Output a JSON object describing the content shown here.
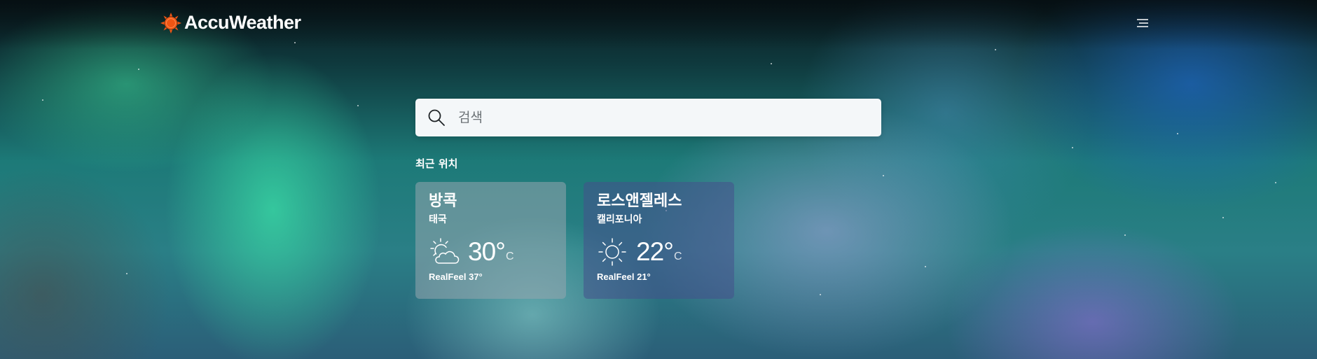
{
  "brand": {
    "name": "AccuWeather",
    "accent_color": "#f05514"
  },
  "header": {
    "menu_icon": "menu-icon"
  },
  "search": {
    "placeholder": "검색",
    "value": "",
    "icon": "search-icon"
  },
  "recent": {
    "title": "최근 위치",
    "locations": [
      {
        "city": "방콕",
        "region": "태국",
        "temp": "30°",
        "unit": "C",
        "realfeel": "RealFeel 37°",
        "icon": "partly-sunny-icon"
      },
      {
        "city": "로스앤젤레스",
        "region": "캘리포니아",
        "temp": "22°",
        "unit": "C",
        "realfeel": "RealFeel 21°",
        "icon": "sunny-icon"
      }
    ]
  }
}
